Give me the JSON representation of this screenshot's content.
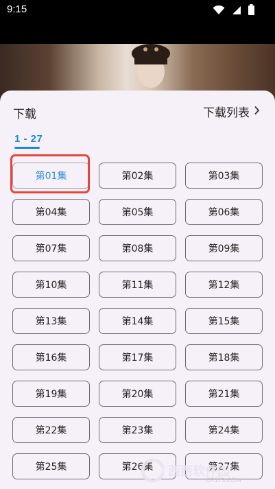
{
  "status_bar": {
    "time": "9:15",
    "icons": [
      "wifi-icon",
      "signal-icon",
      "battery-icon"
    ]
  },
  "sheet": {
    "title": "下载",
    "download_list_label": "下载列表",
    "range_tab": "1 - 27",
    "episodes": [
      "第01集",
      "第02集",
      "第03集",
      "第04集",
      "第05集",
      "第06集",
      "第07集",
      "第08集",
      "第09集",
      "第10集",
      "第11集",
      "第12集",
      "第13集",
      "第14集",
      "第15集",
      "第16集",
      "第17集",
      "第18集",
      "第19集",
      "第20集",
      "第21集",
      "第22集",
      "第23集",
      "第24集",
      "第25集",
      "第26集",
      "第27集"
    ],
    "selected_episode": "第01集"
  },
  "watermark": {
    "text": "西西软件园",
    "sub": "CR173.COM"
  },
  "colors": {
    "accent": "#1e88d6",
    "sheet_bg": "#f6f1f8",
    "highlight": "#e2463b"
  }
}
